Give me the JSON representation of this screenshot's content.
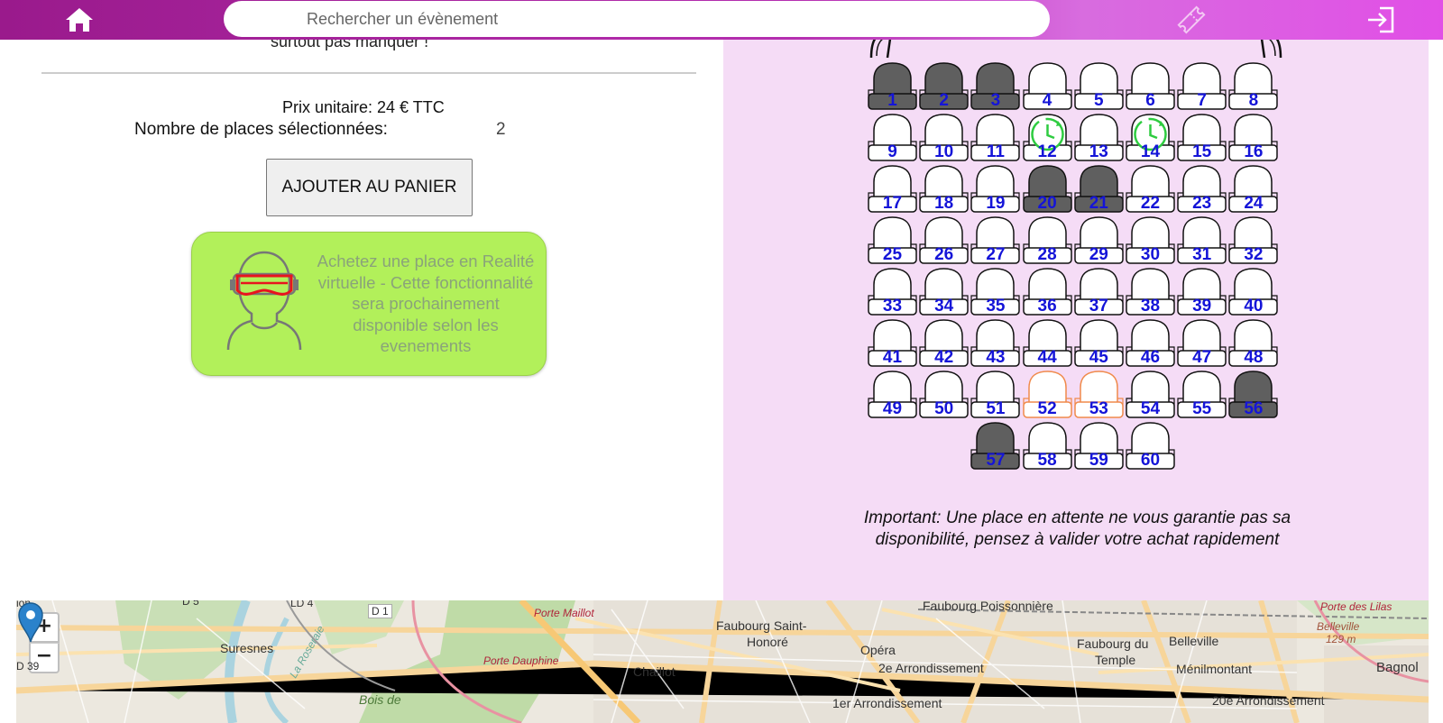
{
  "topbar": {
    "search_placeholder": "Rechercher un évènement",
    "home_icon": "home-icon",
    "ticket_icon": "ticket-icon",
    "login_icon": "login-icon"
  },
  "left": {
    "cut_text": "surtout pas manquer !",
    "price_label": "Prix unitaire: 24 € TTC",
    "count_label": "Nombre de places sélectionnées:",
    "count_value": "2",
    "add_cart_label": "AJOUTER AU PANIER",
    "vr_text": "Achetez une place en Realité virtuelle - Cette fonctionnalité sera prochainement disponible selon les evenements"
  },
  "seats": [
    {
      "n": "1",
      "s": "taken"
    },
    {
      "n": "2",
      "s": "taken"
    },
    {
      "n": "3",
      "s": "taken"
    },
    {
      "n": "4",
      "s": "free"
    },
    {
      "n": "5",
      "s": "free"
    },
    {
      "n": "6",
      "s": "free"
    },
    {
      "n": "7",
      "s": "free"
    },
    {
      "n": "8",
      "s": "free"
    },
    {
      "n": "9",
      "s": "free"
    },
    {
      "n": "10",
      "s": "free"
    },
    {
      "n": "11",
      "s": "free"
    },
    {
      "n": "12",
      "s": "pending"
    },
    {
      "n": "13",
      "s": "free"
    },
    {
      "n": "14",
      "s": "pending"
    },
    {
      "n": "15",
      "s": "free"
    },
    {
      "n": "16",
      "s": "free"
    },
    {
      "n": "17",
      "s": "free"
    },
    {
      "n": "18",
      "s": "free"
    },
    {
      "n": "19",
      "s": "free"
    },
    {
      "n": "20",
      "s": "taken"
    },
    {
      "n": "21",
      "s": "taken"
    },
    {
      "n": "22",
      "s": "free"
    },
    {
      "n": "23",
      "s": "free"
    },
    {
      "n": "24",
      "s": "free"
    },
    {
      "n": "25",
      "s": "free"
    },
    {
      "n": "26",
      "s": "free"
    },
    {
      "n": "27",
      "s": "free"
    },
    {
      "n": "28",
      "s": "free"
    },
    {
      "n": "29",
      "s": "free"
    },
    {
      "n": "30",
      "s": "free"
    },
    {
      "n": "31",
      "s": "free"
    },
    {
      "n": "32",
      "s": "free"
    },
    {
      "n": "33",
      "s": "free"
    },
    {
      "n": "34",
      "s": "free"
    },
    {
      "n": "35",
      "s": "free"
    },
    {
      "n": "36",
      "s": "free"
    },
    {
      "n": "37",
      "s": "free"
    },
    {
      "n": "38",
      "s": "free"
    },
    {
      "n": "39",
      "s": "free"
    },
    {
      "n": "40",
      "s": "free"
    },
    {
      "n": "41",
      "s": "free"
    },
    {
      "n": "42",
      "s": "free"
    },
    {
      "n": "43",
      "s": "free"
    },
    {
      "n": "44",
      "s": "free"
    },
    {
      "n": "45",
      "s": "free"
    },
    {
      "n": "46",
      "s": "free"
    },
    {
      "n": "47",
      "s": "free"
    },
    {
      "n": "48",
      "s": "free"
    },
    {
      "n": "49",
      "s": "free"
    },
    {
      "n": "50",
      "s": "free"
    },
    {
      "n": "51",
      "s": "free"
    },
    {
      "n": "52",
      "s": "selected"
    },
    {
      "n": "53",
      "s": "selected"
    },
    {
      "n": "54",
      "s": "free"
    },
    {
      "n": "55",
      "s": "free"
    },
    {
      "n": "56",
      "s": "taken"
    },
    {
      "n": "57",
      "s": "taken"
    },
    {
      "n": "58",
      "s": "free"
    },
    {
      "n": "59",
      "s": "free"
    },
    {
      "n": "60",
      "s": "free"
    }
  ],
  "seat_colors": {
    "taken": "#5f5f5f",
    "free": "#ffffff",
    "selected": "#ffffff",
    "pending": "#ffffff",
    "selected_outline": "#f08a4b",
    "pending_icon": "#2ecc40",
    "number": "#1414d8"
  },
  "note": "Important: Une place en attente ne vous garantie pas sa disponibilité, pensez à valider votre achat rapidement",
  "map": {
    "zoom_in": "+",
    "zoom_out": "−",
    "labels": {
      "l_ion": "ion",
      "l_d5": "D 5",
      "l_ld4": "LD 4",
      "l_d1": "D 1",
      "l_porte_maillot": "Porte Maillot",
      "l_faubourg_st": "Faubourg Saint-",
      "l_honore": "Honoré",
      "l_faubourg_poiss": "Faubourg Poissonnière",
      "l_belleville_h": "Belleville",
      "l_129m": "129 m",
      "l_porte_lilas": "Porte des Lilas",
      "l_suresnes": "Suresnes",
      "l_rosiere": "La Roseraie",
      "l_porte_dauphine": "Porte Dauphine",
      "l_chaillot": "Chaillot",
      "l_opera": "Opéra",
      "l_2e": "2e Arrondissement",
      "l_faubourg_du": "Faubourg du",
      "l_temple": "Temple",
      "l_belleville": "Belleville",
      "l_menilmontant": "Ménilmontant",
      "l_bagnol": "Bagnol",
      "l_d39": "D 39",
      "l_bois": "Bois de",
      "l_1er": "1er Arrondissement",
      "l_20e": "20e Arrondissement"
    },
    "marker_icon": "map-pin-icon"
  }
}
